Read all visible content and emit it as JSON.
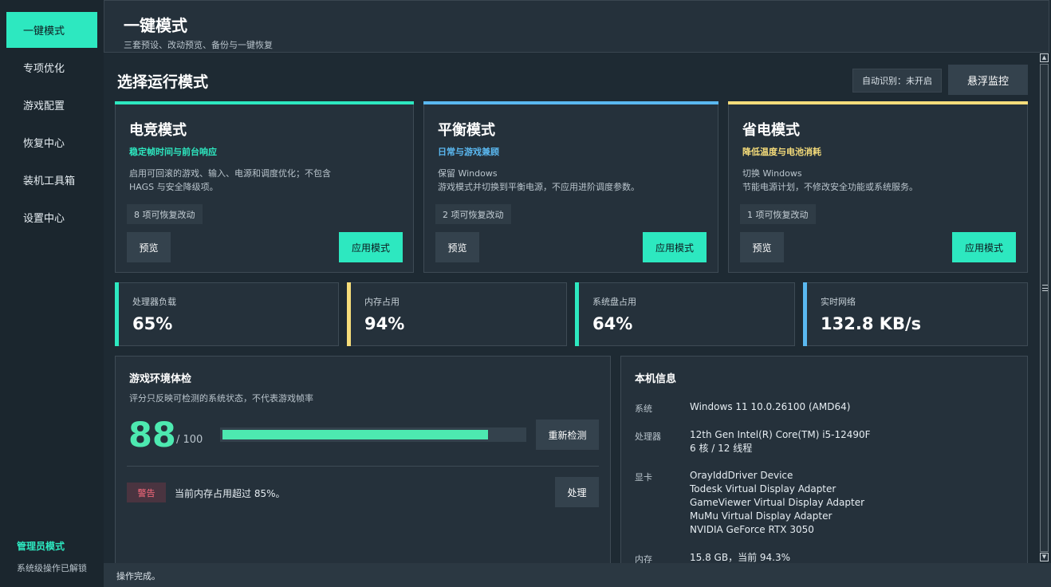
{
  "sidebar": {
    "items": [
      {
        "label": "一键模式"
      },
      {
        "label": "专项优化"
      },
      {
        "label": "游戏配置"
      },
      {
        "label": "恢复中心"
      },
      {
        "label": "装机工具箱"
      },
      {
        "label": "设置中心"
      }
    ],
    "active_index": 0,
    "admin_title": "管理员模式",
    "admin_sub": "系统级操作已解锁"
  },
  "header": {
    "title": "一键模式",
    "subtitle": "三套预设、改动预览、备份与一键恢复"
  },
  "section": {
    "title": "选择运行模式",
    "auto_detect": "自动识别：未开启",
    "float_monitor": "悬浮监控"
  },
  "modes": [
    {
      "name": "电竞模式",
      "tag": "稳定帧时间与前台响应",
      "desc_line1": "启用可回滚的游戏、输入、电源和调度优化；不包含",
      "desc_line2": "HAGS 与安全降级项。",
      "count": "8 项可恢复改动",
      "preview": "预览",
      "apply": "应用模式",
      "accent": "#2de8c0",
      "tag_color": "#2de8c0"
    },
    {
      "name": "平衡模式",
      "tag": "日常与游戏兼顾",
      "desc_line1": "保留 Windows",
      "desc_line2": "游戏模式并切换到平衡电源，不应用进阶调度参数。",
      "count": "2 项可恢复改动",
      "preview": "预览",
      "apply": "应用模式",
      "accent": "#5ab8f0",
      "tag_color": "#5ab8f0"
    },
    {
      "name": "省电模式",
      "tag": "降低温度与电池消耗",
      "desc_line1": "切换 Windows",
      "desc_line2": "节能电源计划，不修改安全功能或系统服务。",
      "count": "1 项可恢复改动",
      "preview": "预览",
      "apply": "应用模式",
      "accent": "#f5dc7a",
      "tag_color": "#f5dc7a"
    }
  ],
  "stats": [
    {
      "label": "处理器负载",
      "value": "65%",
      "accent": "#2de8c0"
    },
    {
      "label": "内存占用",
      "value": "94%",
      "accent": "#f5dc7a"
    },
    {
      "label": "系统盘占用",
      "value": "64%",
      "accent": "#2de8c0"
    },
    {
      "label": "实时网络",
      "value": "132.8 KB/s",
      "accent": "#5ab8f0"
    }
  ],
  "health": {
    "title": "游戏环境体检",
    "subtitle": "评分只反映可检测的系统状态，不代表游戏帧率",
    "score": "88",
    "score_max": "/ 100",
    "score_fraction": 0.88,
    "recheck": "重新检测",
    "warning_badge": "警告",
    "warning_text": "当前内存占用超过 85%。",
    "handle": "处理"
  },
  "info": {
    "title": "本机信息",
    "system_label": "系统",
    "system_value": "Windows 11 10.0.26100 (AMD64)",
    "cpu_label": "处理器",
    "cpu_line1": "12th Gen Intel(R) Core(TM) i5-12490F",
    "cpu_line2": "6 核 / 12 线程",
    "gpu_label": "显卡",
    "gpu_lines": [
      "OrayIddDriver Device",
      "Todesk Virtual Display Adapter",
      "GameViewer Virtual Display Adapter",
      "MuMu Virtual Display Adapter",
      "NVIDIA GeForce RTX 3050"
    ],
    "mem_label": "内存",
    "mem_value": "15.8 GB，当前 94.3%"
  },
  "status": "操作完成。"
}
